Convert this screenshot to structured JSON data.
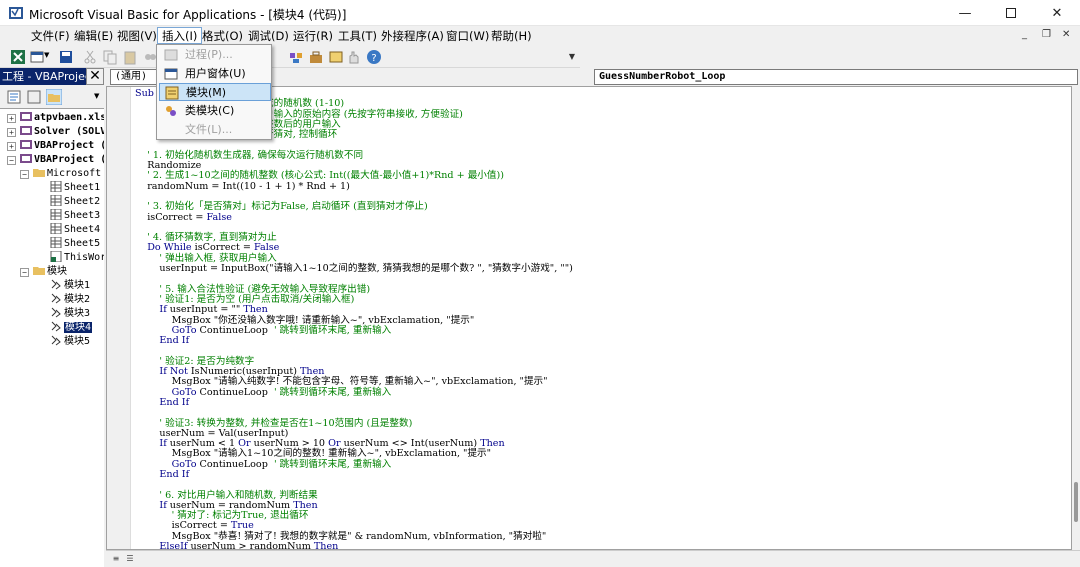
{
  "window": {
    "title": "Microsoft Visual Basic for Applications - [模块4 (代码)]"
  },
  "menubar": [
    {
      "label": "文件(F)"
    },
    {
      "label": "编辑(E)"
    },
    {
      "label": "视图(V)"
    },
    {
      "label": "插入(I)"
    },
    {
      "label": "格式(O)"
    },
    {
      "label": "调试(D)"
    },
    {
      "label": "运行(R)"
    },
    {
      "label": "工具(T)"
    },
    {
      "label": "外接程序(A)"
    },
    {
      "label": "窗口(W)"
    },
    {
      "label": "帮助(H)"
    }
  ],
  "insert_menu": {
    "items": [
      {
        "label": "过程(P)...",
        "enabled": false,
        "icon": "procedure-icon"
      },
      {
        "label": "用户窗体(U)",
        "enabled": true,
        "icon": "userform-icon"
      },
      {
        "label": "模块(M)",
        "enabled": true,
        "highlighted": true,
        "icon": "module-icon"
      },
      {
        "label": "类模块(C)",
        "enabled": true,
        "icon": "class-module-icon"
      },
      {
        "label": "文件(L)...",
        "enabled": false,
        "icon": "file-icon"
      }
    ]
  },
  "project": {
    "header": "工程 - VBAProject",
    "close": "✕",
    "tree": [
      {
        "label": "atpvbaen.xls"
      },
      {
        "label": "Solver (SOLV"
      },
      {
        "label": "VBAProject ("
      },
      {
        "label": "VBAProject ("
      },
      {
        "label": "Microsoft"
      },
      {
        "label": "Sheet1"
      },
      {
        "label": "Sheet2"
      },
      {
        "label": "Sheet3"
      },
      {
        "label": "Sheet4"
      },
      {
        "label": "Sheet5"
      },
      {
        "label": "ThisWor"
      },
      {
        "label": "模块"
      },
      {
        "label": "模块1"
      },
      {
        "label": "模块2"
      },
      {
        "label": "模块3"
      },
      {
        "label": "模块4",
        "selected": true
      },
      {
        "label": "模块5"
      }
    ]
  },
  "code_window": {
    "object_combo": "(通用)",
    "procedure_combo": "GuessNumberRobot_Loop",
    "lines": [
      {
        "text": "Sub G"
      },
      {
        "text": "                              '  机器生成的随机数 (1-10)"
      },
      {
        "text": "                              '  存储用户输入的原始内容 (先按字符串接收, 方便验证)"
      },
      {
        "text": "                              '  转换为整数后的用户输入"
      },
      {
        "text": "                              '  标记是否猜对, 控制循环"
      },
      {
        "text": ""
      },
      {
        "text": "    ' 1. 初始化随机数生成器, 确保每次运行随机数不同"
      },
      {
        "text": "    Randomize"
      },
      {
        "text": "    ' 2. 生成1~10之间的随机整数 (核心公式: Int((最大值-最小值+1)*Rnd + 最小值))"
      },
      {
        "text": "    randomNum = Int((10 - 1 + 1) * Rnd + 1)"
      },
      {
        "text": ""
      },
      {
        "text": "    ' 3. 初始化「是否猜对」标记为False, 启动循环 (直到猜对才停止)"
      },
      {
        "text": "    isCorrect = False"
      },
      {
        "text": ""
      },
      {
        "text": "    ' 4. 循环猜数字, 直到猜对为止"
      },
      {
        "text": "    Do While isCorrect = False"
      },
      {
        "text": "        ' 弹出输入框, 获取用户输入"
      },
      {
        "text": "        userInput = InputBox(\"请输入1~10之间的整数, 猜猜我想的是哪个数? \", \"猜数字小游戏\", \"\")"
      },
      {
        "text": ""
      },
      {
        "text": "        ' 5. 输入合法性验证 (避免无效输入导致程序出错)"
      },
      {
        "text": "        ' 验证1: 是否为空 (用户点击取消/关闭输入框)"
      },
      {
        "text": "        If userInput = \"\" Then"
      },
      {
        "text": "            MsgBox \"你还没输入数字哦! 请重新输入~\", vbExclamation, \"提示\""
      },
      {
        "text": "            GoTo ContinueLoop  ' 跳转到循环末尾, 重新输入"
      },
      {
        "text": "        End If"
      },
      {
        "text": ""
      },
      {
        "text": "        ' 验证2: 是否为纯数字"
      },
      {
        "text": "        If Not IsNumeric(userInput) Then"
      },
      {
        "text": "            MsgBox \"请输入纯数字! 不能包含字母、符号等, 重新输入~\", vbExclamation, \"提示\""
      },
      {
        "text": "            GoTo ContinueLoop  ' 跳转到循环末尾, 重新输入"
      },
      {
        "text": "        End If"
      },
      {
        "text": ""
      },
      {
        "text": "        ' 验证3: 转换为整数, 并检查是否在1~10范围内 (且是整数)"
      },
      {
        "text": "        userNum = Val(userInput)"
      },
      {
        "text": "        If userNum < 1 Or userNum > 10 Or userNum <> Int(userNum) Then"
      },
      {
        "text": "            MsgBox \"请输入1~10之间的整数! 重新输入~\", vbExclamation, \"提示\""
      },
      {
        "text": "            GoTo ContinueLoop  ' 跳转到循环末尾, 重新输入"
      },
      {
        "text": "        End If"
      },
      {
        "text": ""
      },
      {
        "text": "        ' 6. 对比用户输入和随机数, 判断结果"
      },
      {
        "text": "        If userNum = randomNum Then"
      },
      {
        "text": "            ' 猜对了: 标记为True, 退出循环"
      },
      {
        "text": "            isCorrect = True"
      },
      {
        "text": "            MsgBox \"恭喜! 猜对了! 我想的数字就是\" & randomNum, vbInformation, \"猜对啦\""
      },
      {
        "text": "        ElseIf userNum > randomNum Then"
      }
    ]
  },
  "colors": {
    "keyword": "#00008b",
    "comment": "#008000",
    "selection": "#0a246a",
    "menu_highlight": "#cce4f7"
  }
}
